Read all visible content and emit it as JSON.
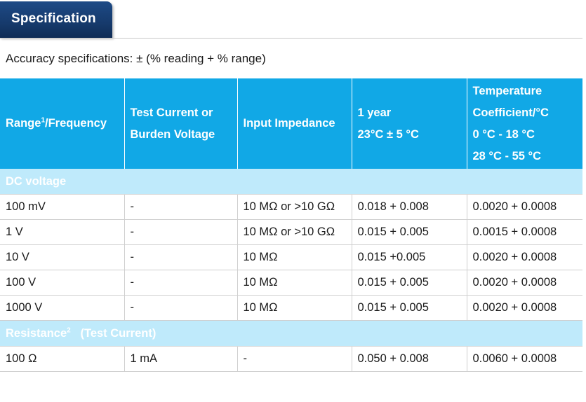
{
  "header": {
    "tab_label": "Specification"
  },
  "intro": "Accuracy specifications: ± (% reading + % range)",
  "table": {
    "headers": {
      "range_prefix": "Range",
      "range_sup": "1",
      "range_suffix": "/Frequency",
      "test_current_line1": "Test Current or",
      "test_current_line2": "Burden Voltage",
      "input_impedance": "Input Impedance",
      "one_year_line1": "1 year",
      "one_year_line2": "23°C ± 5 °C",
      "temp_line1": "Temperature",
      "temp_line2": "Coefficient/°C",
      "temp_line3": "0 °C - 18 °C",
      "temp_line4": "28 °C - 55 °C"
    },
    "sections": [
      {
        "title": "DC voltage",
        "title_sup": "",
        "title_suffix": "",
        "rows": [
          [
            "100 mV",
            "-",
            "10 MΩ or >10 GΩ",
            "0.018 + 0.008",
            "0.0020 + 0.0008"
          ],
          [
            "1 V",
            "-",
            "10 MΩ or >10 GΩ",
            "0.015 + 0.005",
            "0.0015 + 0.0008"
          ],
          [
            "10 V",
            "-",
            "10 MΩ",
            "0.015 +0.005",
            "0.0020 + 0.0008"
          ],
          [
            "100 V",
            "-",
            "10 MΩ",
            "0.015 + 0.005",
            "0.0020 + 0.0008"
          ],
          [
            "1000 V",
            "-",
            "10 MΩ",
            "0.015 + 0.005",
            "0.0020 + 0.0008"
          ]
        ]
      },
      {
        "title": "Resistance",
        "title_sup": "2",
        "title_suffix": "(Test Current)",
        "rows": [
          [
            "100 Ω",
            "1 mA",
            "-",
            "0.050 + 0.008",
            "0.0060 + 0.0008"
          ]
        ]
      }
    ]
  }
}
